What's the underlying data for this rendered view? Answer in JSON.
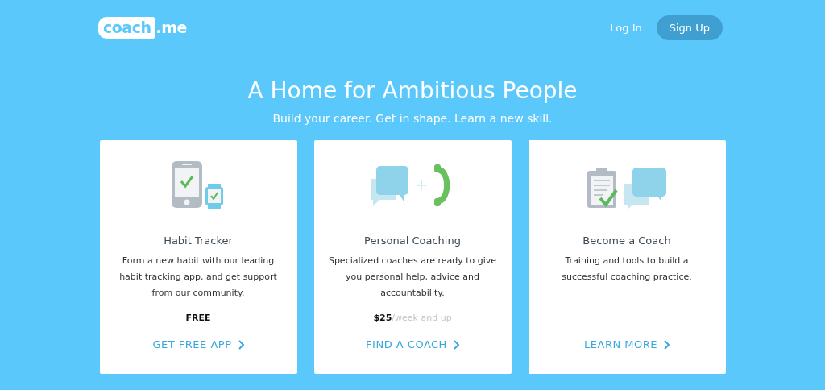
{
  "header": {
    "logo": {
      "word": "coach",
      "suffix": ".me"
    },
    "login": "Log In",
    "signup": "Sign Up"
  },
  "hero": {
    "title": "A Home for Ambitious People",
    "subtitle": "Build your career. Get in shape. Learn a new skill."
  },
  "cards": [
    {
      "kind": "phone-watch",
      "title": "Habit Tracker",
      "text": "Form a new habit with our leading habit tracking app, and get support from our community.",
      "price": "FREE",
      "link": "GET FREE APP"
    },
    {
      "kind": "chat-phone",
      "title": "Personal Coaching",
      "text": "Specialized coaches are ready to give you personal help, advice and accountability.",
      "price": "$25",
      "price_note": "/week and up",
      "link": "FIND A COACH"
    },
    {
      "kind": "clipboard-chat",
      "title": "Become a Coach",
      "text": "Training and tools to build a successful coaching practice.",
      "link": "LEARN MORE"
    }
  ]
}
